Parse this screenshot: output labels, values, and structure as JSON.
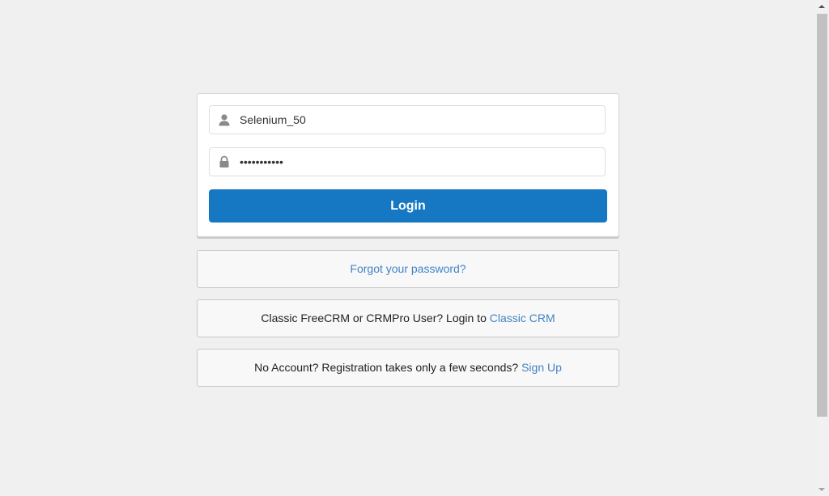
{
  "login_form": {
    "username_value": "Selenium_50",
    "password_masked": "•••••••••••",
    "login_label": "Login",
    "username_icon": "user-icon",
    "password_icon": "lock-icon"
  },
  "forgot": {
    "link_text": "Forgot your password?"
  },
  "classic": {
    "text": "Classic FreeCRM or CRMPro User? Login to ",
    "link_text": "Classic CRM"
  },
  "signup": {
    "text": "No Account? Registration takes only a few seconds? ",
    "link_text": "Sign Up"
  },
  "colors": {
    "background": "#f0f0f0",
    "primary_button": "#1678c2",
    "link": "#4183c4"
  }
}
